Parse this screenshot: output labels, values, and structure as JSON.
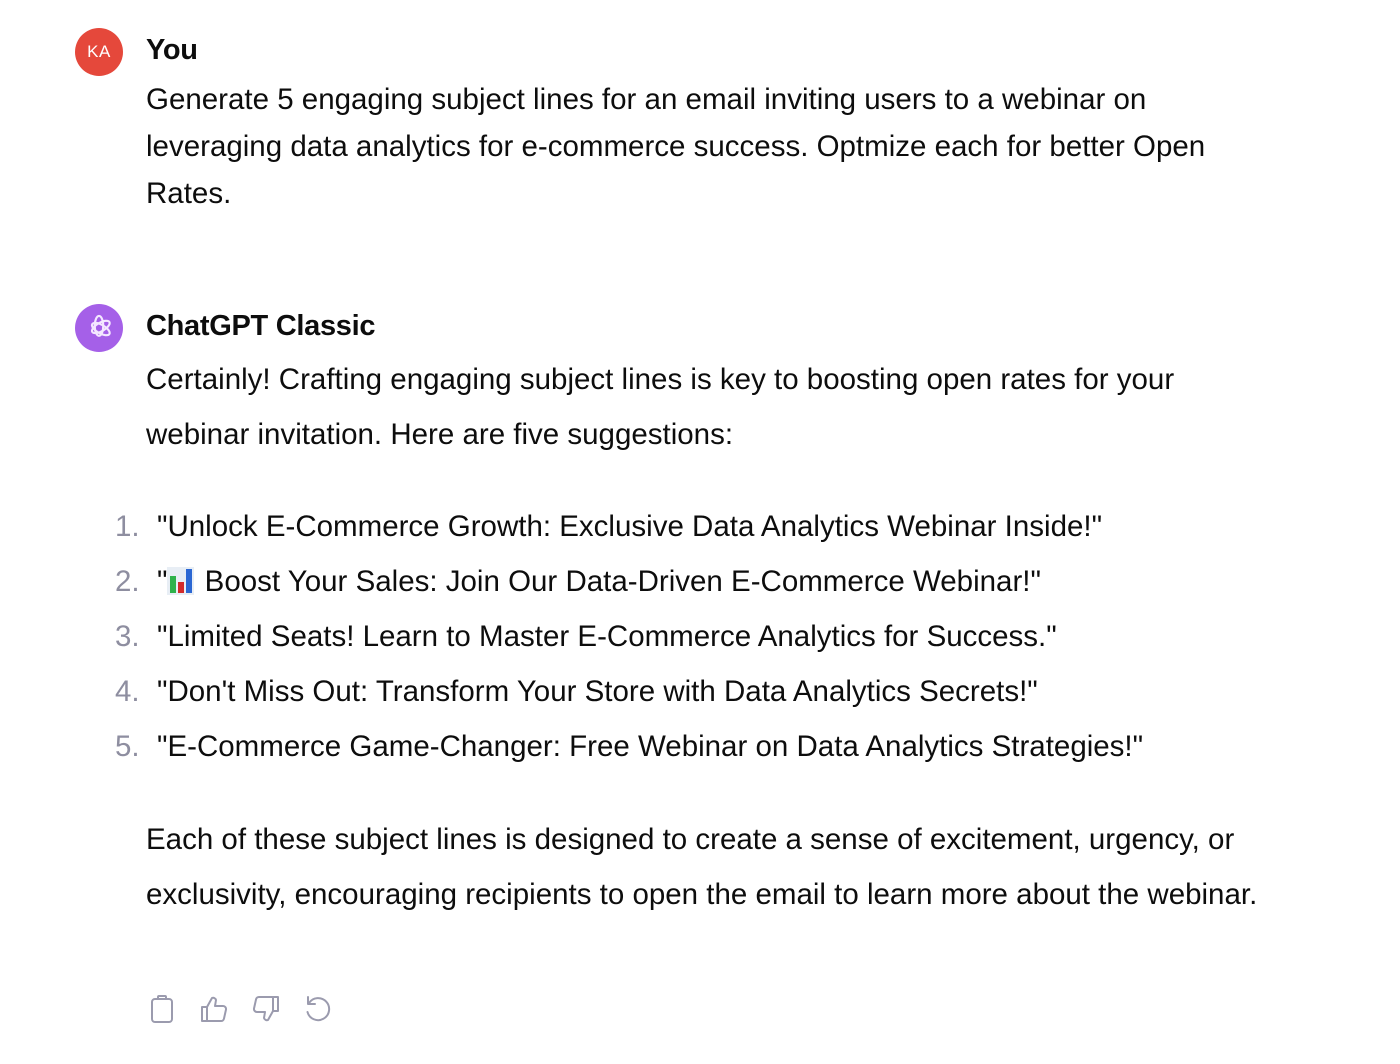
{
  "conversation": {
    "user_message": {
      "avatar_initials": "KA",
      "avatar_color": "#e5483b",
      "author": "You",
      "text": "Generate 5 engaging subject lines for an email inviting users to a webinar on leveraging data analytics for e-commerce success. Optmize each for better Open Rates."
    },
    "assistant_message": {
      "avatar_icon": "openai-logo-icon",
      "avatar_color": "#a560e8",
      "author": "ChatGPT Classic",
      "intro": "Certainly! Crafting engaging subject lines is key to boosting open rates for your webinar invitation. Here are five suggestions:",
      "list": [
        {
          "num": "1.",
          "pre": "\"",
          "emoji": "",
          "text": "\"Unlock E-Commerce Growth: Exclusive Data Analytics Webinar Inside!\""
        },
        {
          "num": "2.",
          "pre": "\"",
          "emoji": "bar-chart",
          "text": " Boost Your Sales: Join Our Data-Driven E-Commerce Webinar!\""
        },
        {
          "num": "3.",
          "pre": "",
          "emoji": "",
          "text": "\"Limited Seats! Learn to Master E-Commerce Analytics for Success.\""
        },
        {
          "num": "4.",
          "pre": "",
          "emoji": "",
          "text": "\"Don't Miss Out: Transform Your Store with Data Analytics Secrets!\""
        },
        {
          "num": "5.",
          "pre": "",
          "emoji": "",
          "text": "\"E-Commerce Game-Changer: Free Webinar on Data Analytics Strategies!\""
        }
      ],
      "outro": "Each of these subject lines is designed to create a sense of excitement, urgency, or exclusivity, encouraging recipients to open the email to learn more about the webinar.",
      "actions": [
        {
          "name": "copy",
          "icon": "clipboard-icon"
        },
        {
          "name": "thumbs-up",
          "icon": "thumbs-up-icon"
        },
        {
          "name": "thumbs-down",
          "icon": "thumbs-down-icon"
        },
        {
          "name": "regenerate",
          "icon": "regenerate-icon"
        }
      ]
    }
  }
}
